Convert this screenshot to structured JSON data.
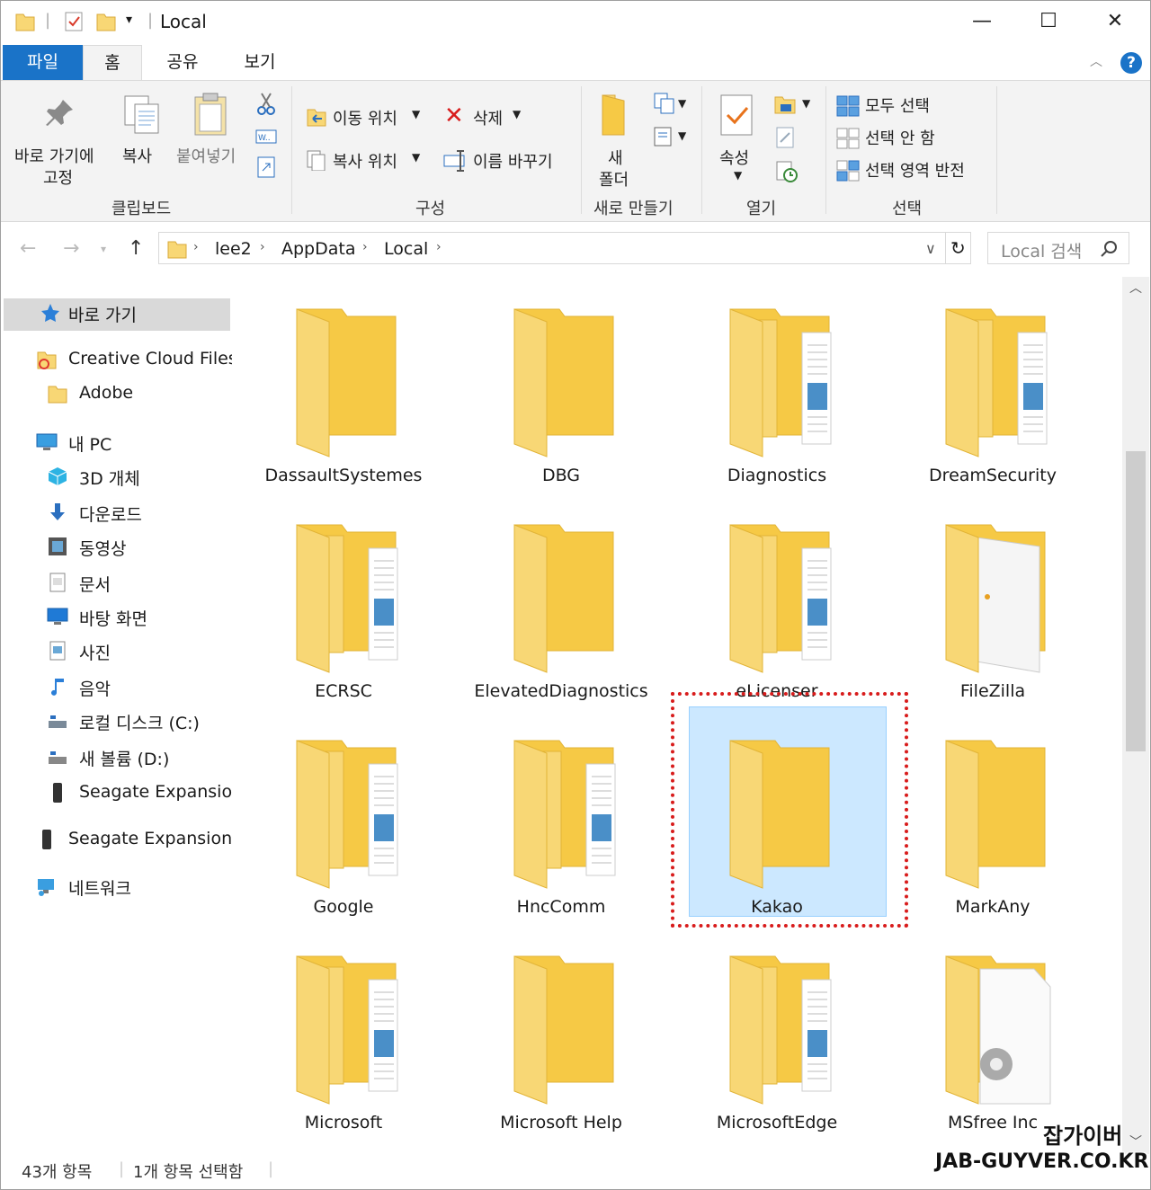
{
  "window": {
    "title": "Local",
    "minimize": "—",
    "maximize": "☐",
    "close": "✕"
  },
  "ribbon_tabs": [
    "파일",
    "홈",
    "공유",
    "보기"
  ],
  "ribbon": {
    "clipboard": {
      "pin_label_1": "바로 가기에",
      "pin_label_2": "고정",
      "copy": "복사",
      "paste": "붙여넣기",
      "group": "클립보드"
    },
    "organize": {
      "move_to": "이동 위치",
      "copy_to": "복사 위치",
      "delete": "삭제",
      "rename": "이름 바꾸기",
      "group": "구성"
    },
    "new": {
      "new_folder_1": "새",
      "new_folder_2": "폴더",
      "group": "새로 만들기"
    },
    "open": {
      "properties": "속성",
      "group": "열기"
    },
    "select": {
      "select_all": "모두 선택",
      "select_none": "선택 안 함",
      "invert": "선택 영역 반전",
      "group": "선택"
    }
  },
  "address": {
    "crumbs": [
      "lee2",
      "AppData",
      "Local"
    ],
    "search_placeholder": "Local 검색"
  },
  "sidebar": [
    {
      "label": "바로 가기",
      "icon": "star-icon"
    },
    {
      "label": "Creative Cloud Files",
      "icon": "creative-cloud-icon"
    },
    {
      "label": "Adobe",
      "icon": "folder-icon"
    },
    {
      "label": "내 PC",
      "icon": "pc-icon"
    },
    {
      "label": "3D 개체",
      "icon": "3d-objects-icon"
    },
    {
      "label": "다운로드",
      "icon": "download-icon"
    },
    {
      "label": "동영상",
      "icon": "video-icon"
    },
    {
      "label": "문서",
      "icon": "document-icon"
    },
    {
      "label": "바탕 화면",
      "icon": "desktop-icon"
    },
    {
      "label": "사진",
      "icon": "pictures-icon"
    },
    {
      "label": "음악",
      "icon": "music-icon"
    },
    {
      "label": "로컬 디스크 (C:)",
      "icon": "disk-icon"
    },
    {
      "label": "새 볼륨 (D:)",
      "icon": "drive-icon"
    },
    {
      "label": "Seagate Expansion",
      "icon": "external-drive-icon"
    },
    {
      "label": "Seagate Expansion D",
      "icon": "external-drive-icon"
    },
    {
      "label": "네트워크",
      "icon": "network-icon"
    }
  ],
  "folders": [
    {
      "name": "DassaultSystemes",
      "kind": "plain"
    },
    {
      "name": "DBG",
      "kind": "plain"
    },
    {
      "name": "Diagnostics",
      "kind": "docs"
    },
    {
      "name": "DreamSecurity",
      "kind": "docs"
    },
    {
      "name": "ECRSC",
      "kind": "docs"
    },
    {
      "name": "ElevatedDiagnostics",
      "kind": "plain"
    },
    {
      "name": "eLicenser",
      "kind": "docs"
    },
    {
      "name": "FileZilla",
      "kind": "paper"
    },
    {
      "name": "Google",
      "kind": "docs"
    },
    {
      "name": "HncComm",
      "kind": "docs"
    },
    {
      "name": "Kakao",
      "kind": "plain"
    },
    {
      "name": "MarkAny",
      "kind": "plain"
    },
    {
      "name": "Microsoft",
      "kind": "docs"
    },
    {
      "name": "Microsoft Help",
      "kind": "plain"
    },
    {
      "name": "MicrosoftEdge",
      "kind": "docs"
    },
    {
      "name": "MSfree Inc",
      "kind": "gear"
    }
  ],
  "selected_folder": "Kakao",
  "status": {
    "count": "43개 항목",
    "selected": "1개 항목 선택함"
  },
  "watermark": {
    "line1": "잡가이버",
    "line2": "JAB-GUYVER.CO.KR"
  },
  "colors": {
    "accent": "#1a73c8",
    "selection": "#cce8ff",
    "highlight_box": "#d81c1c",
    "folder": "#f8d775"
  }
}
